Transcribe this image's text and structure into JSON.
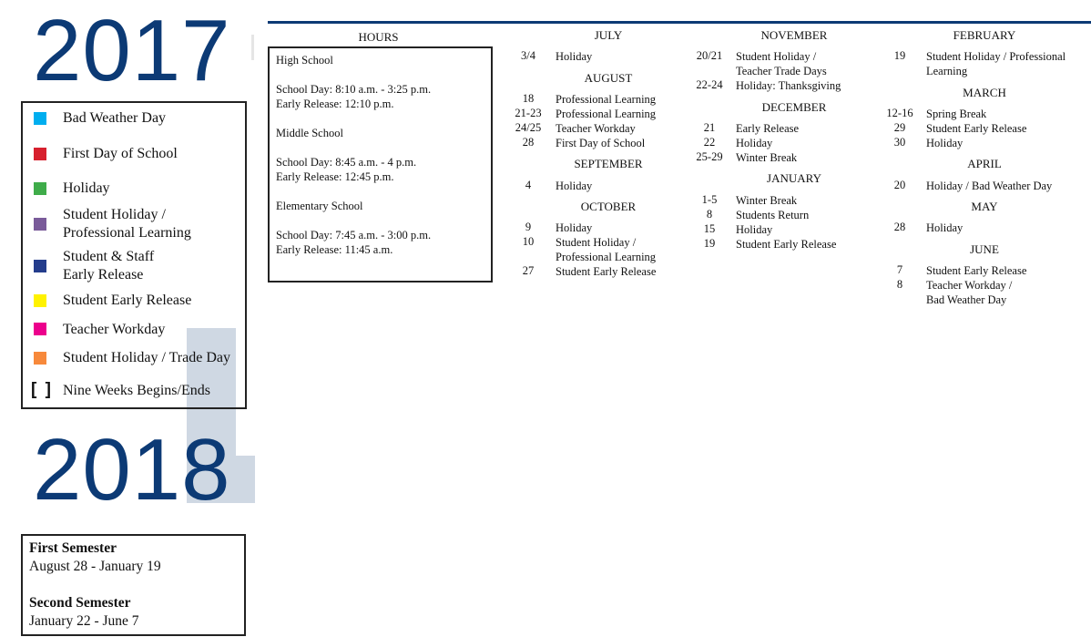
{
  "years": {
    "start": "2017",
    "end": "2018"
  },
  "legend": {
    "items": [
      {
        "label": "Bad Weather Day",
        "color": "#00aeef",
        "icon": "square"
      },
      {
        "label": "First Day of School",
        "color": "#d7202e",
        "icon": "square"
      },
      {
        "label": "Holiday",
        "color": "#3fac4a",
        "icon": "square"
      },
      {
        "label": "Student Holiday /",
        "label2": "Professional Learning",
        "color": "#7a5b9a",
        "icon": "square"
      },
      {
        "label": "Student & Staff",
        "label2": "Early Release",
        "color": "#243d8c",
        "icon": "square"
      },
      {
        "label": "Student Early Release",
        "color": "#fff200",
        "icon": "square"
      },
      {
        "label": "Teacher Workday",
        "color": "#ec008c",
        "icon": "square"
      },
      {
        "label": "Student Holiday / Trade Day",
        "color": "#f7893b",
        "icon": "square"
      },
      {
        "label": "Nine Weeks Begins/Ends",
        "icon": "bracket",
        "glyph": "[ ]"
      }
    ]
  },
  "semesters": [
    {
      "title": "First Semester",
      "dates": "August 28 - January 19"
    },
    {
      "title": "Second Semester",
      "dates": "January 22 - June 7"
    }
  ],
  "hours": {
    "heading": "HOURS",
    "lines": [
      "High School",
      "School Day: 8:10 a.m. - 3:25 p.m.",
      "Early Release: 12:10 p.m.",
      "Middle School",
      "School Day: 8:45 a.m. - 4 p.m.",
      "Early Release: 12:45 p.m.",
      "Elementary School",
      "School Day: 7:45 a.m. - 3:00 p.m.",
      "Early Release: 11:45 a.m."
    ]
  },
  "months": {
    "july": {
      "name": "JULY",
      "events": [
        {
          "date": "3/4",
          "desc": [
            "Holiday"
          ]
        }
      ]
    },
    "august": {
      "name": "AUGUST",
      "events": [
        {
          "date": "18",
          "desc": [
            "Professional Learning"
          ]
        },
        {
          "date": "21-23",
          "desc": [
            "Professional Learning"
          ]
        },
        {
          "date": "24/25",
          "desc": [
            "Teacher Workday"
          ]
        },
        {
          "date": "28",
          "desc": [
            "First Day of School"
          ]
        }
      ]
    },
    "september": {
      "name": "SEPTEMBER",
      "events": [
        {
          "date": "4",
          "desc": [
            "Holiday"
          ]
        }
      ]
    },
    "october": {
      "name": "OCTOBER",
      "events": [
        {
          "date": "9",
          "desc": [
            "Holiday"
          ]
        },
        {
          "date": "10",
          "desc": [
            "Student Holiday /",
            "Professional Learning"
          ]
        },
        {
          "date": "27",
          "desc": [
            "Student Early Release"
          ]
        }
      ]
    },
    "november": {
      "name": "NOVEMBER",
      "events": [
        {
          "date": "20/21",
          "desc": [
            "Student Holiday /",
            "Teacher Trade Days"
          ]
        },
        {
          "date": "22-24",
          "desc": [
            "Holiday: Thanksgiving"
          ]
        }
      ]
    },
    "december": {
      "name": "DECEMBER",
      "events": [
        {
          "date": "21",
          "desc": [
            "Early Release"
          ]
        },
        {
          "date": "22",
          "desc": [
            "Holiday"
          ]
        },
        {
          "date": "25-29",
          "desc": [
            "Winter Break"
          ]
        }
      ]
    },
    "january": {
      "name": "JANUARY",
      "events": [
        {
          "date": "1-5",
          "desc": [
            "Winter Break"
          ]
        },
        {
          "date": "8",
          "desc": [
            "Students Return"
          ]
        },
        {
          "date": "15",
          "desc": [
            "Holiday"
          ]
        },
        {
          "date": "19",
          "desc": [
            "Student Early Release"
          ]
        }
      ]
    },
    "february": {
      "name": "FEBRUARY",
      "events": [
        {
          "date": "19",
          "desc": [
            "Student Holiday / Professional",
            "Learning"
          ]
        }
      ]
    },
    "march": {
      "name": "MARCH",
      "events": [
        {
          "date": "12-16",
          "desc": [
            "Spring Break"
          ]
        },
        {
          "date": "29",
          "desc": [
            "Student Early Release"
          ]
        },
        {
          "date": "30",
          "desc": [
            "Holiday"
          ]
        }
      ]
    },
    "april": {
      "name": "APRIL",
      "events": [
        {
          "date": "20",
          "desc": [
            "Holiday / Bad Weather Day"
          ]
        }
      ]
    },
    "may": {
      "name": "MAY",
      "events": [
        {
          "date": "28",
          "desc": [
            "Holiday"
          ]
        }
      ]
    },
    "june": {
      "name": "JUNE",
      "events": [
        {
          "date": "7",
          "desc": [
            "Student Early Release"
          ]
        },
        {
          "date": "8",
          "desc": [
            "Teacher Workday /",
            "Bad Weather Day"
          ]
        }
      ]
    }
  }
}
